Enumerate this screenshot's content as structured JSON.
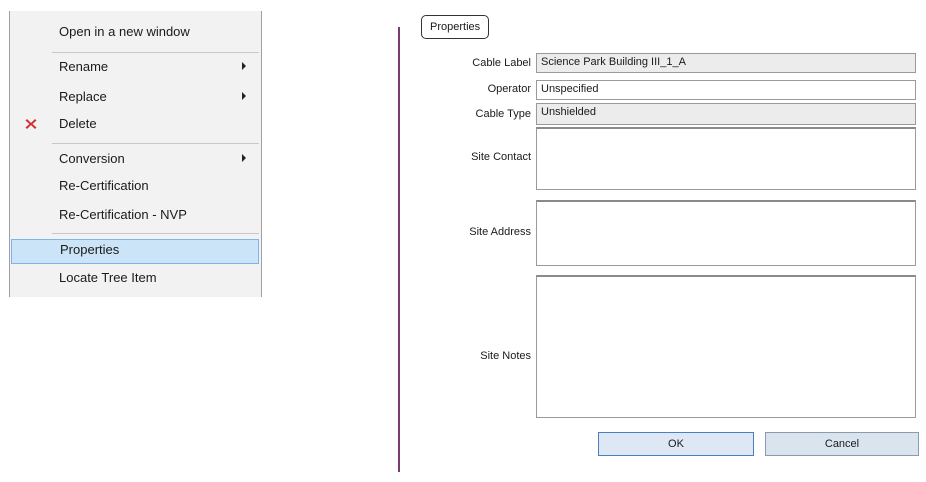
{
  "context_menu": {
    "items": [
      {
        "label": "Open in a new window"
      },
      {
        "label": "Rename"
      },
      {
        "label": "Replace"
      },
      {
        "label": "Delete"
      },
      {
        "label": "Conversion"
      },
      {
        "label": "Re-Certification"
      },
      {
        "label": "Re-Certification - NVP"
      },
      {
        "label": "Properties"
      },
      {
        "label": "Locate Tree Item"
      }
    ],
    "selected_color": "#cce4f7",
    "delete_icon_color": "#d42b2b"
  },
  "dialog": {
    "tab_title": "Properties",
    "fields": {
      "cable_label": {
        "label": "Cable Label",
        "value": "Science Park Building III_1_A"
      },
      "operator": {
        "label": "Operator",
        "value": "Unspecified"
      },
      "cable_type": {
        "label": "Cable Type",
        "value": "Unshielded"
      },
      "site_contact": {
        "label": "Site Contact",
        "value": ""
      },
      "site_address": {
        "label": "Site Address",
        "value": ""
      },
      "site_notes": {
        "label": "Site Notes",
        "value": ""
      }
    },
    "ok_label": "OK",
    "cancel_label": "Cancel",
    "accent": "#7a3a72"
  }
}
